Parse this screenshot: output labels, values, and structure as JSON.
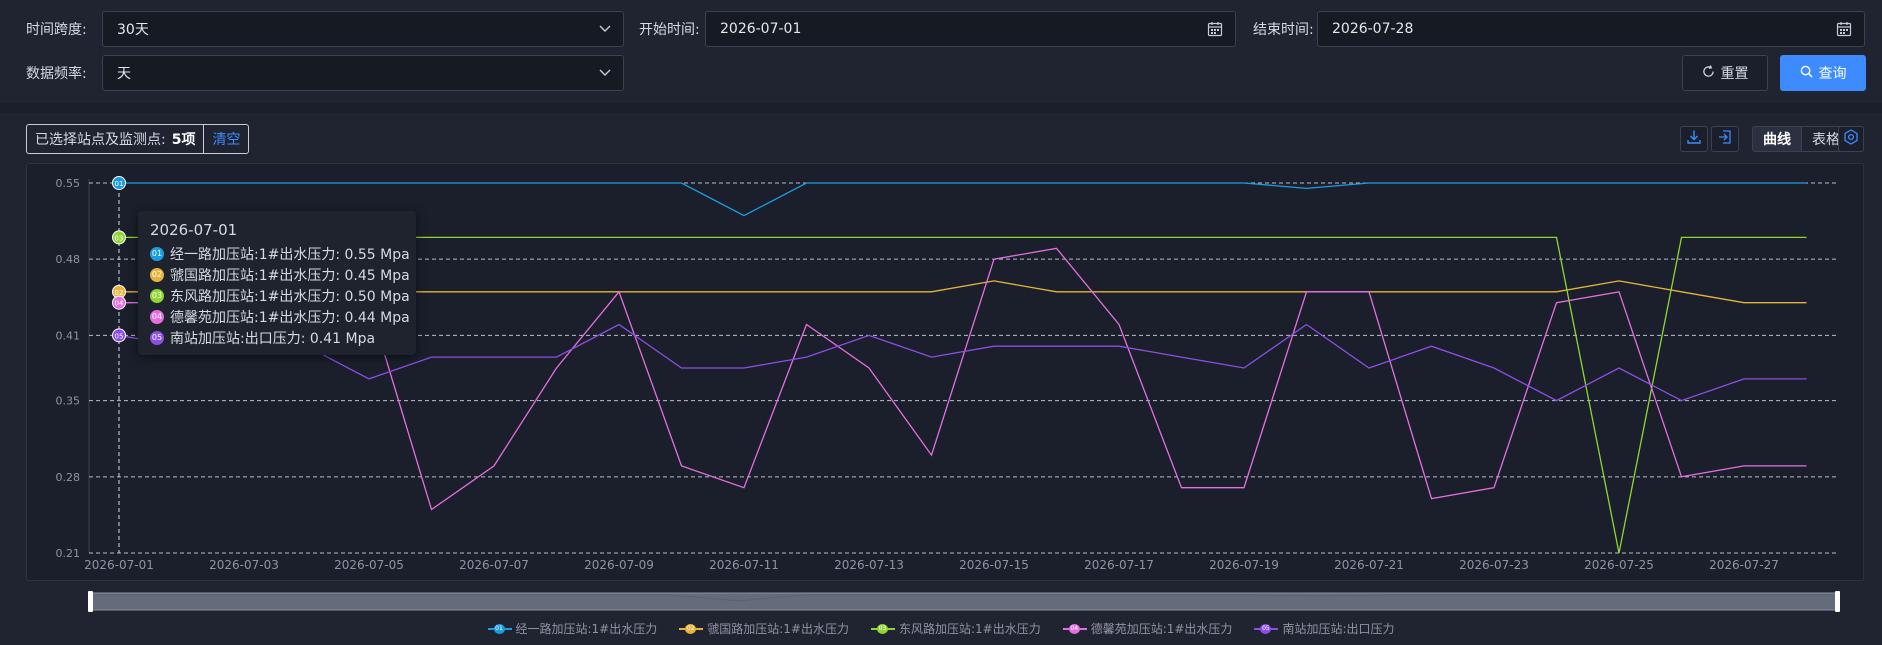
{
  "filters": {
    "span_label": "时间跨度:",
    "span_value": "30天",
    "start_label": "开始时间:",
    "start_value": "2026-07-01",
    "end_label": "结束时间:",
    "end_value": "2026-07-28",
    "freq_label": "数据频率:",
    "freq_value": "天",
    "reset_label": "重置",
    "query_label": "查询"
  },
  "toolbar": {
    "selected_label": "已选择站点及监测点:",
    "selected_count": "5项",
    "clear_label": "清空",
    "view_curve": "曲线",
    "view_table": "表格"
  },
  "tooltip": {
    "date": "2026-07-01",
    "rows": [
      {
        "badge": "01",
        "text": "经一路加压站:1#出水压力:  0.55 Mpa"
      },
      {
        "badge": "02",
        "text": "虢国路加压站:1#出水压力:  0.45 Mpa"
      },
      {
        "badge": "03",
        "text": "东风路加压站:1#出水压力:  0.50 Mpa"
      },
      {
        "badge": "04",
        "text": "德馨苑加压站:1#出水压力:  0.44 Mpa"
      },
      {
        "badge": "05",
        "text": "南站加压站:出口压力:  0.41 Mpa"
      }
    ]
  },
  "colors": {
    "accent": "#3d8bff",
    "s1": "#1a9de0",
    "s2": "#e6b43a",
    "s3": "#8fd633",
    "s4": "#e36fe0",
    "s5": "#8d4ee6"
  },
  "chart_data": {
    "type": "line",
    "x": [
      "2026-07-01",
      "2026-07-02",
      "2026-07-03",
      "2026-07-04",
      "2026-07-05",
      "2026-07-06",
      "2026-07-07",
      "2026-07-08",
      "2026-07-09",
      "2026-07-10",
      "2026-07-11",
      "2026-07-12",
      "2026-07-13",
      "2026-07-14",
      "2026-07-15",
      "2026-07-16",
      "2026-07-17",
      "2026-07-18",
      "2026-07-19",
      "2026-07-20",
      "2026-07-21",
      "2026-07-22",
      "2026-07-23",
      "2026-07-24",
      "2026-07-25",
      "2026-07-26",
      "2026-07-27",
      "2026-07-28"
    ],
    "x_ticks": [
      "2026-07-01",
      "2026-07-03",
      "2026-07-05",
      "2026-07-07",
      "2026-07-09",
      "2026-07-11",
      "2026-07-13",
      "2026-07-15",
      "2026-07-17",
      "2026-07-19",
      "2026-07-21",
      "2026-07-23",
      "2026-07-25",
      "2026-07-27"
    ],
    "y_ticks": [
      "0.21",
      "0.28",
      "0.35",
      "0.41",
      "0.48",
      "0.55"
    ],
    "ylim": [
      0.21,
      0.55
    ],
    "grid": true,
    "legend_position": "bottom",
    "series": [
      {
        "badge": "01",
        "name": "经一路加压站:1#出水压力",
        "color": "#1a9de0",
        "values": [
          0.55,
          0.55,
          0.55,
          0.55,
          0.55,
          0.55,
          0.55,
          0.55,
          0.55,
          0.55,
          0.52,
          0.55,
          0.55,
          0.55,
          0.55,
          0.55,
          0.55,
          0.55,
          0.55,
          0.545,
          0.55,
          0.55,
          0.55,
          0.55,
          0.55,
          0.55,
          0.55,
          0.55
        ]
      },
      {
        "badge": "02",
        "name": "虢国路加压站:1#出水压力",
        "color": "#e6b43a",
        "values": [
          0.45,
          0.45,
          0.45,
          0.45,
          0.45,
          0.45,
          0.45,
          0.45,
          0.45,
          0.45,
          0.45,
          0.45,
          0.45,
          0.45,
          0.46,
          0.45,
          0.45,
          0.45,
          0.45,
          0.45,
          0.45,
          0.45,
          0.45,
          0.45,
          0.46,
          0.45,
          0.44,
          0.44
        ]
      },
      {
        "badge": "03",
        "name": "东风路加压站:1#出水压力",
        "color": "#8fd633",
        "values": [
          0.5,
          0.5,
          0.5,
          0.5,
          0.5,
          0.5,
          0.5,
          0.5,
          0.5,
          0.5,
          0.5,
          0.5,
          0.5,
          0.5,
          0.5,
          0.5,
          0.5,
          0.5,
          0.5,
          0.5,
          0.5,
          0.5,
          0.5,
          0.5,
          0.21,
          0.5,
          0.5,
          0.5
        ]
      },
      {
        "badge": "04",
        "name": "德馨苑加压站:1#出水压力",
        "color": "#e36fe0",
        "values": [
          0.44,
          0.44,
          0.44,
          0.44,
          0.44,
          0.25,
          0.29,
          0.38,
          0.45,
          0.29,
          0.27,
          0.42,
          0.38,
          0.3,
          0.48,
          0.49,
          0.42,
          0.27,
          0.27,
          0.45,
          0.45,
          0.26,
          0.27,
          0.44,
          0.45,
          0.28,
          0.29,
          0.29
        ]
      },
      {
        "badge": "05",
        "name": "南站加压站:出口压力",
        "color": "#8d4ee6",
        "values": [
          0.41,
          0.4,
          0.4,
          0.4,
          0.37,
          0.39,
          0.39,
          0.39,
          0.42,
          0.38,
          0.38,
          0.39,
          0.41,
          0.39,
          0.4,
          0.4,
          0.4,
          0.39,
          0.38,
          0.42,
          0.38,
          0.4,
          0.38,
          0.35,
          0.38,
          0.35,
          0.37,
          0.37
        ]
      }
    ]
  }
}
